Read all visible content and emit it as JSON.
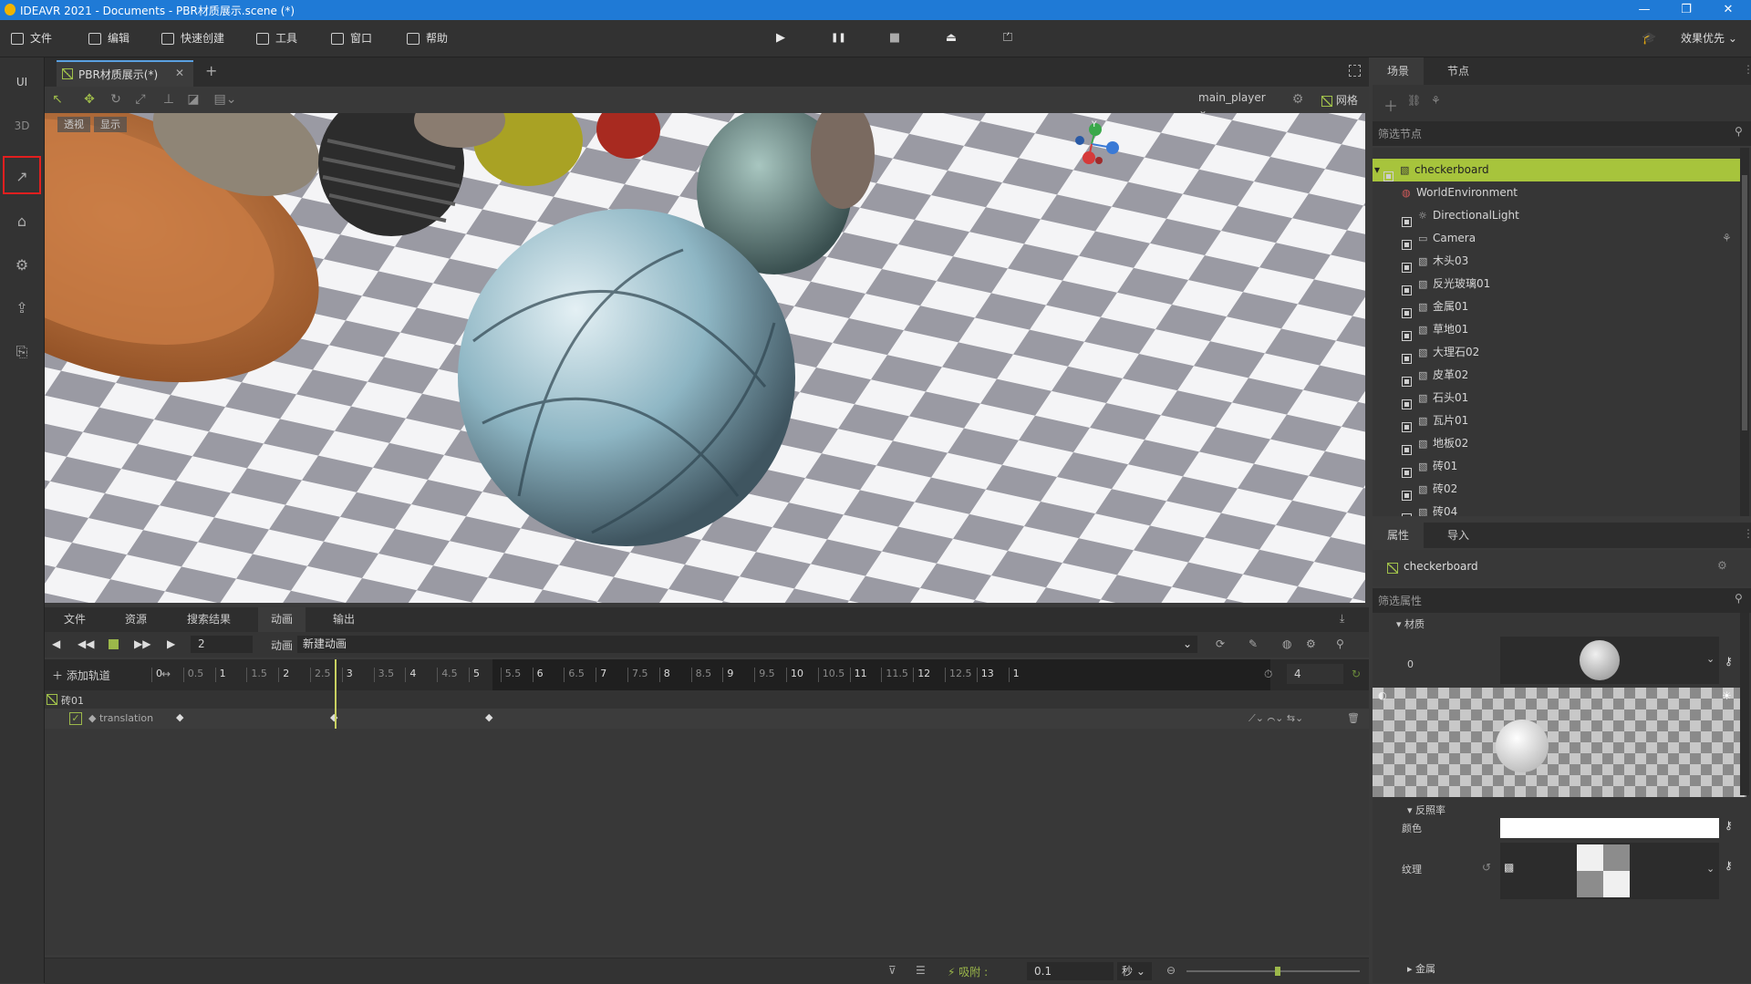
{
  "window": {
    "title": "IDEAVR 2021 - Documents - PBR材质展示.scene (*)",
    "minimize": "—",
    "restore": "❐",
    "close": "✕"
  },
  "menubar": {
    "items": [
      "文件",
      "编辑",
      "快速创建",
      "工具",
      "窗口",
      "帮助"
    ],
    "play_icons": [
      "▶",
      "❚❚",
      "■",
      "⏏",
      "⏍"
    ],
    "quality": "效果优先"
  },
  "left_toolbar": {
    "items": [
      "UI",
      "3D",
      "↗",
      "⌂",
      "⚙",
      "⇪",
      "⎘"
    ]
  },
  "document": {
    "tab_label": "PBR材质展示(*)",
    "tab_close": "✕",
    "add_tab": "+"
  },
  "viewport": {
    "mode_persp": "透视",
    "mode_show": "显示",
    "player": "main_player",
    "grid_label": "网格",
    "gizmo_y": "Y"
  },
  "bottom_panel": {
    "tabs": [
      "文件",
      "资源",
      "搜索结果",
      "动画",
      "输出"
    ],
    "active_tab": "动画",
    "frame_value": "2",
    "anim_label": "动画",
    "anim_name": "新建动画",
    "add_track": "添加轨道",
    "ruler_ticks": [
      "0",
      "0.5",
      "1",
      "1.5",
      "2",
      "2.5",
      "3",
      "3.5",
      "4",
      "4.5",
      "5",
      "5.5",
      "6",
      "6.5",
      "7",
      "7.5",
      "8",
      "8.5",
      "9",
      "9.5",
      "10",
      "10.5",
      "11",
      "11.5",
      "12",
      "12.5",
      "13",
      "1"
    ],
    "length_value": "4",
    "track_group": "砖01",
    "track_property": "translation",
    "snap_label": "吸附 :",
    "snap_value": "0.1",
    "unit": "秒"
  },
  "scene_panel": {
    "tabs": [
      "场景",
      "节点"
    ],
    "filter_placeholder": "筛选节点",
    "nodes": [
      "checkerboard",
      "WorldEnvironment",
      "DirectionalLight",
      "Camera",
      "木头03",
      "反光玻璃01",
      "金属01",
      "草地01",
      "大理石02",
      "皮革02",
      "石头01",
      "瓦片01",
      "地板02",
      "砖01",
      "砖02",
      "砖04"
    ]
  },
  "inspector": {
    "tabs": [
      "属性",
      "导入"
    ],
    "node_name": "checkerboard",
    "filter_placeholder": "筛选属性",
    "section_material": "材质",
    "material_index": "0",
    "section_albedo": "反照率",
    "color_label": "颜色",
    "texture_label": "纹理",
    "section_metal": "金属"
  },
  "colors": {
    "accent": "#1f7ad6",
    "selection": "#a7c43c",
    "highlight_box": "#e21f1f",
    "playhead": "#c8d060"
  }
}
